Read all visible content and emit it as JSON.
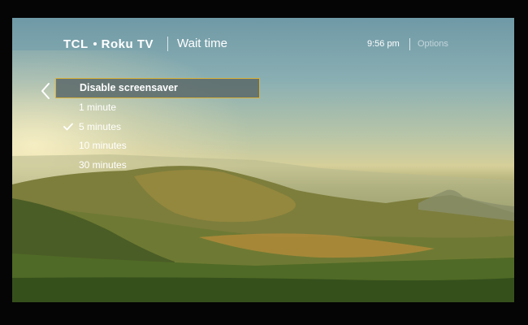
{
  "header": {
    "brand_tcl": "TCL",
    "brand_roku": "Roku TV",
    "title": "Wait time",
    "time": "9:56 pm",
    "options": "Options"
  },
  "menu": {
    "items": [
      {
        "label": "Disable screensaver",
        "selected": true,
        "checked": false
      },
      {
        "label": "1 minute",
        "selected": false,
        "checked": false
      },
      {
        "label": "5 minutes",
        "selected": false,
        "checked": true
      },
      {
        "label": "10 minutes",
        "selected": false,
        "checked": false
      },
      {
        "label": "30 minutes",
        "selected": false,
        "checked": false
      }
    ]
  },
  "colors": {
    "focus_border": "#d9b23b",
    "text": "#ffffff",
    "options_text": "#ffffff8c"
  },
  "icons": {
    "back": "chevron-left-icon",
    "check": "checkmark-icon"
  }
}
